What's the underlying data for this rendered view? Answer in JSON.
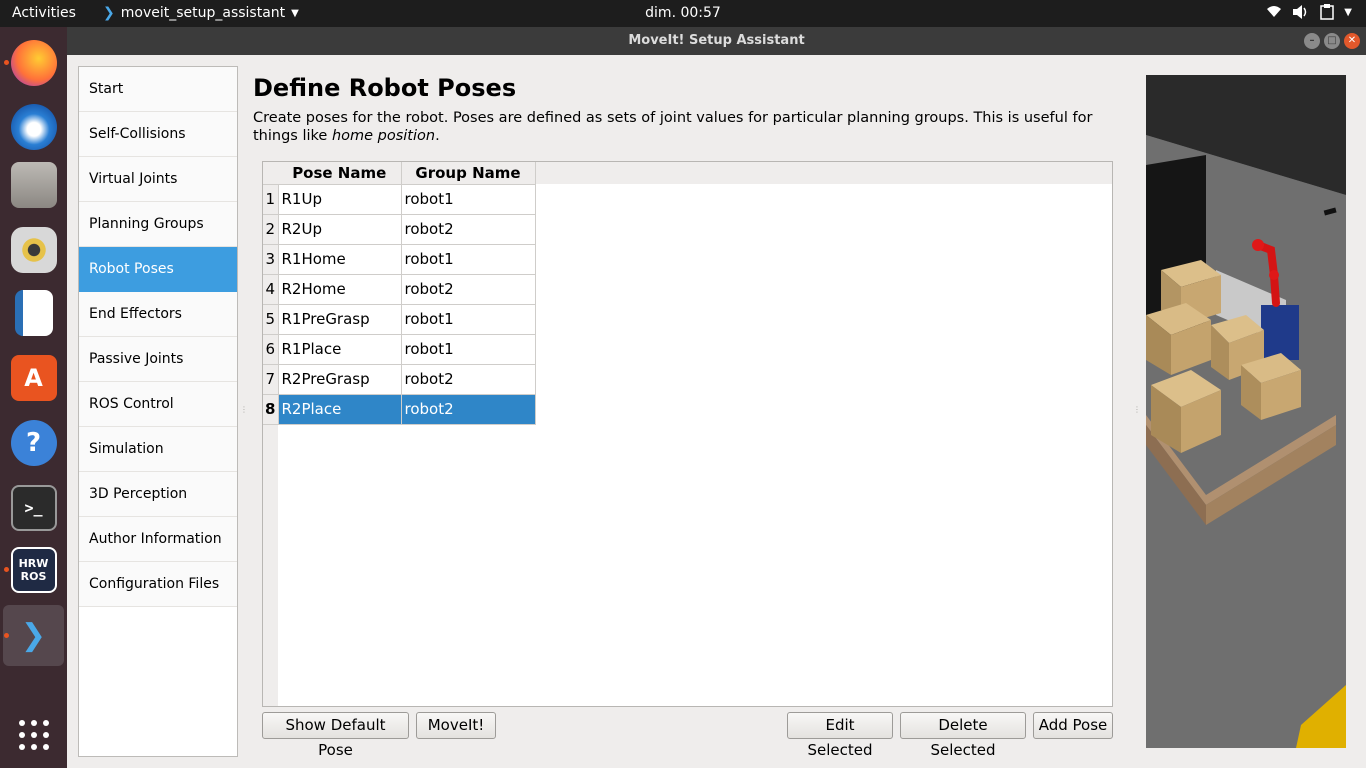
{
  "topbar": {
    "activities": "Activities",
    "app_name": "moveit_setup_assistant",
    "clock": "dim. 00:57"
  },
  "window": {
    "title": "MoveIt! Setup Assistant"
  },
  "dock": {
    "items": [
      {
        "name": "firefox-icon",
        "color": "#ff7139",
        "running": true
      },
      {
        "name": "thunderbird-icon",
        "color": "#2a7fd4",
        "running": false
      },
      {
        "name": "files-icon",
        "color": "#9a9792",
        "running": false
      },
      {
        "name": "rhythmbox-icon",
        "color": "#e6c24a",
        "running": false
      },
      {
        "name": "libreoffice-writer-icon",
        "color": "#2a6fb5",
        "running": false
      },
      {
        "name": "ubuntu-software-icon",
        "color": "#e95420",
        "running": false
      },
      {
        "name": "help-icon",
        "color": "#3b82d8",
        "running": false
      },
      {
        "name": "terminal-icon",
        "color": "#2b2b2b",
        "running": false
      },
      {
        "name": "hrw-ros-icon",
        "color": "#1f2a44",
        "label": "HRW ROS",
        "running": true
      },
      {
        "name": "moveit-icon",
        "color": "#2a6fb5",
        "running": true,
        "active": true
      },
      {
        "name": "show-applications-icon",
        "color": "transparent",
        "running": false
      }
    ]
  },
  "nav": {
    "items": [
      {
        "label": "Start"
      },
      {
        "label": "Self-Collisions"
      },
      {
        "label": "Virtual Joints"
      },
      {
        "label": "Planning Groups"
      },
      {
        "label": "Robot Poses",
        "selected": true
      },
      {
        "label": "End Effectors"
      },
      {
        "label": "Passive Joints"
      },
      {
        "label": "ROS Control"
      },
      {
        "label": "Simulation"
      },
      {
        "label": "3D Perception"
      },
      {
        "label": "Author Information"
      },
      {
        "label": "Configuration Files"
      }
    ]
  },
  "main": {
    "title": "Define Robot Poses",
    "description": "Create poses for the robot. Poses are defined as sets of joint values for particular planning groups. This is useful for things like ",
    "description_em": "home position",
    "description_end": ".",
    "table": {
      "columns": [
        "Pose Name",
        "Group Name"
      ],
      "rows": [
        {
          "num": "1",
          "pose": "R1Up",
          "group": "robot1"
        },
        {
          "num": "2",
          "pose": "R2Up",
          "group": "robot2"
        },
        {
          "num": "3",
          "pose": "R1Home",
          "group": "robot1"
        },
        {
          "num": "4",
          "pose": "R2Home",
          "group": "robot2"
        },
        {
          "num": "5",
          "pose": "R1PreGrasp",
          "group": "robot1"
        },
        {
          "num": "6",
          "pose": "R1Place",
          "group": "robot1"
        },
        {
          "num": "7",
          "pose": "R2PreGrasp",
          "group": "robot2"
        },
        {
          "num": "8",
          "pose": "R2Place",
          "group": "robot2",
          "selected": true
        }
      ]
    },
    "buttons": {
      "show_default": "Show Default Pose",
      "moveit": "MoveIt!",
      "edit": "Edit Selected",
      "delete": "Delete Selected",
      "add": "Add Pose"
    }
  }
}
